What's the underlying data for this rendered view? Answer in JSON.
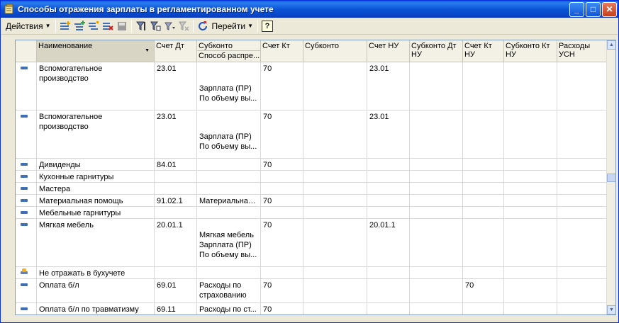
{
  "window": {
    "title": "Способы отражения зарплаты в регламентированном учете"
  },
  "toolbar": {
    "actions_label": "Действия",
    "goto_label": "Перейти",
    "help_label": "?"
  },
  "columns": {
    "name": "Наименование",
    "debit": "Счет Дт",
    "subconto": "Субконто",
    "subconto_sub": "Способ распре...",
    "credit": "Счет Кт",
    "subconto2": "Субконто",
    "account_nu": "Счет НУ",
    "subconto_dt_nu": "Субконто Дт НУ",
    "credit_nu": "Счет Кт НУ",
    "subconto_kt_nu": "Субконто Кт НУ",
    "usn": "Расходы УСН"
  },
  "rows": [
    {
      "icon": "minus-icon",
      "name": "Вспомогательное производство",
      "debit": "23.01",
      "subconto": [
        "",
        "",
        "Зарплата (ПР)",
        "По объему вы..."
      ],
      "credit": "70",
      "subconto2": "",
      "account_nu": "23.01",
      "credit_nu": ""
    },
    {
      "icon": "minus-icon",
      "name": "Вспомогательное производство",
      "debit": "23.01",
      "subconto": [
        "",
        "",
        "Зарплата (ПР)",
        "По объему вы..."
      ],
      "credit": "70",
      "subconto2": "",
      "account_nu": "23.01",
      "credit_nu": ""
    },
    {
      "icon": "minus-icon",
      "name": "Дивиденды",
      "debit": "84.01",
      "subconto": [
        ""
      ],
      "credit": "70",
      "subconto2": "",
      "account_nu": "",
      "credit_nu": ""
    },
    {
      "icon": "minus-icon",
      "name": "Кухонные гарнитуры",
      "debit": "",
      "subconto": [
        ""
      ],
      "credit": "",
      "subconto2": "",
      "account_nu": "",
      "credit_nu": ""
    },
    {
      "icon": "minus-icon",
      "name": "Мастера",
      "debit": "",
      "subconto": [
        ""
      ],
      "credit": "",
      "subconto2": "",
      "account_nu": "",
      "credit_nu": ""
    },
    {
      "icon": "minus-icon",
      "name": "Материальная помощь",
      "debit": "91.02.1",
      "subconto": [
        "Материальная ..."
      ],
      "credit": "70",
      "subconto2": "",
      "account_nu": "",
      "credit_nu": ""
    },
    {
      "icon": "minus-icon",
      "name": "Мебельные гарнитуры",
      "debit": "",
      "subconto": [
        ""
      ],
      "credit": "",
      "subconto2": "",
      "account_nu": "",
      "credit_nu": ""
    },
    {
      "icon": "minus-icon",
      "name": "Мягкая мебель",
      "debit": "20.01.1",
      "subconto": [
        "",
        "Мягкая мебель",
        "Зарплата (ПР)",
        "По объему вы..."
      ],
      "credit": "70",
      "subconto2": "",
      "account_nu": "20.01.1",
      "credit_nu": ""
    },
    {
      "icon": "no-accounting-icon",
      "name": "Не отражать в бухучете",
      "debit": "",
      "subconto": [
        ""
      ],
      "credit": "",
      "subconto2": "",
      "account_nu": "",
      "credit_nu": ""
    },
    {
      "icon": "minus-icon",
      "name": "Оплата б/л",
      "debit": "69.01",
      "subconto": [
        "Расходы по",
        "страхованию"
      ],
      "credit": "70",
      "subconto2": "",
      "account_nu": "",
      "credit_nu": "70"
    },
    {
      "icon": "minus-icon",
      "name": "Оплата б/л по травматизму",
      "debit": "69.11",
      "subconto": [
        "Расходы по ст..."
      ],
      "credit": "70",
      "subconto2": "",
      "account_nu": "",
      "credit_nu": ""
    }
  ]
}
